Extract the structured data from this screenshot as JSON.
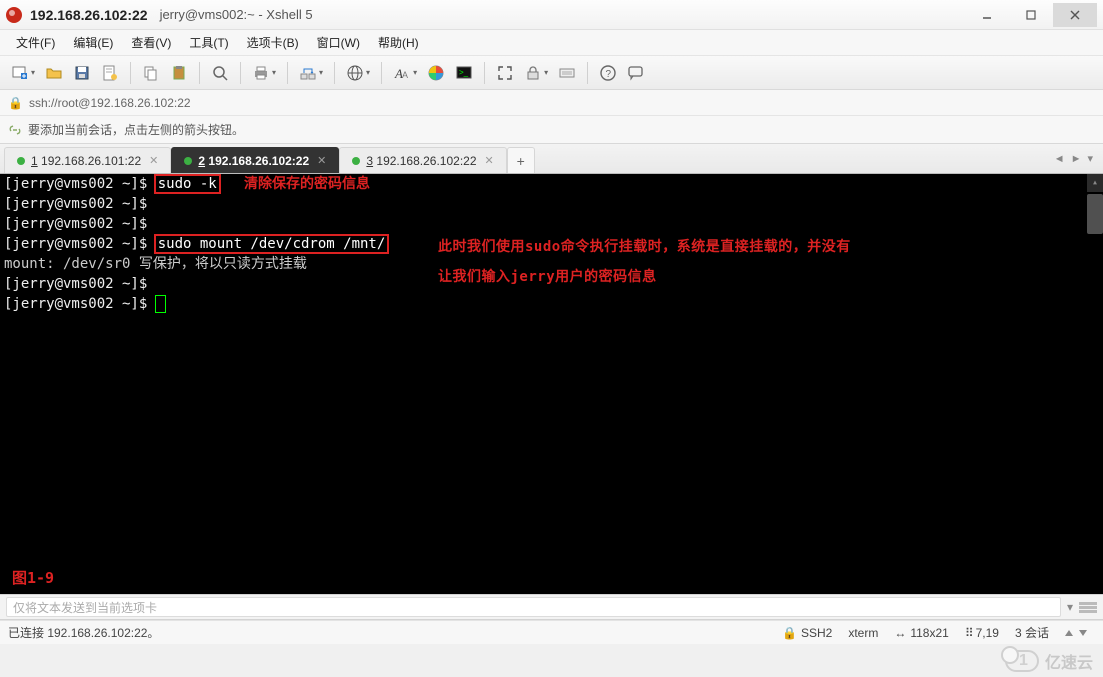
{
  "title": {
    "ip": "192.168.26.102:22",
    "sub": "jerry@vms002:~ - Xshell 5"
  },
  "menu": {
    "file": "文件(F)",
    "edit": "编辑(E)",
    "view": "查看(V)",
    "tools": "工具(T)",
    "tabs": "选项卡(B)",
    "window": "窗口(W)",
    "help": "帮助(H)"
  },
  "address": {
    "url": "ssh://root@192.168.26.102:22"
  },
  "hint": {
    "text": "要添加当前会话，点击左侧的箭头按钮。"
  },
  "tabs": {
    "items": [
      {
        "num": "1",
        "label": "192.168.26.101:22"
      },
      {
        "num": "2",
        "label": "192.168.26.102:22"
      },
      {
        "num": "3",
        "label": "192.168.26.102:22"
      }
    ],
    "add": "+"
  },
  "terminal": {
    "p1": "[jerry@vms002 ~]$ ",
    "cmd1": "sudo -k",
    "note1": "清除保存的密码信息",
    "p2": "[jerry@vms002 ~]$",
    "p3": "[jerry@vms002 ~]$",
    "p4": "[jerry@vms002 ~]$ ",
    "cmd2": "sudo mount /dev/cdrom /mnt/",
    "noteA": "此时我们使用sudo命令执行挂载时，系统是直接挂载的，并没有",
    "out1": "mount: /dev/sr0 写保护，将以只读方式挂载",
    "noteB": "让我们输入jerry用户的密码信息",
    "p5": "[jerry@vms002 ~]$",
    "p6": "[jerry@vms002 ~]$ ",
    "fig": "图1-9"
  },
  "send": {
    "placeholder": "仅将文本发送到当前选项卡"
  },
  "status": {
    "conn": "已连接 192.168.26.102:22。",
    "proto": "SSH2",
    "term": "xterm",
    "size": "118x21",
    "pos": "7,19",
    "sess": "3 会话"
  },
  "watermark": "亿速云",
  "icons": {
    "new": "new-tab-icon",
    "open": "folder-open-icon",
    "save": "save-icon",
    "properties": "properties-icon",
    "copy": "copy-icon",
    "paste": "paste-icon",
    "search": "search-icon",
    "print": "print-icon",
    "transfer": "transfer-icon",
    "globe": "globe-icon",
    "font": "font-icon",
    "color": "color-wheel-icon",
    "terminal": "terminal-icon",
    "fullscreen": "fullscreen-icon",
    "lock": "lock-icon",
    "keyboard": "keyboard-icon",
    "help": "help-icon",
    "chat": "chat-icon"
  }
}
